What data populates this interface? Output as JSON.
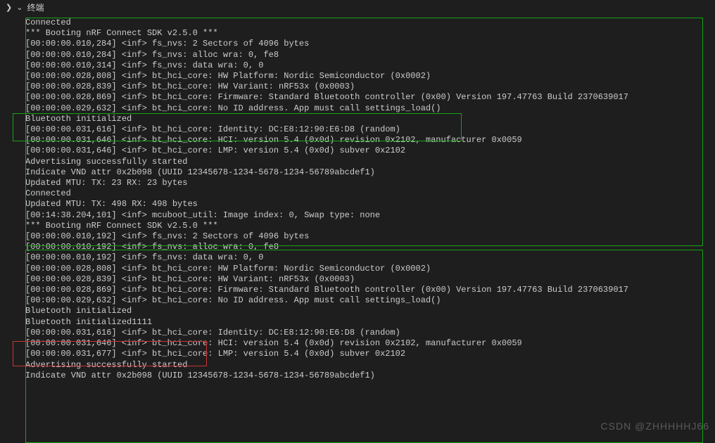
{
  "header": {
    "tab_label": "终端"
  },
  "terminal": {
    "lines": [
      "Connected",
      "*** Booting nRF Connect SDK v2.5.0 ***",
      "[00:00:00.010,284] <inf> fs_nvs: 2 Sectors of 4096 bytes",
      "[00:00:00.010,284] <inf> fs_nvs: alloc wra: 0, fe8",
      "[00:00:00.010,314] <inf> fs_nvs: data wra: 0, 0",
      "[00:00:00.028,808] <inf> bt_hci_core: HW Platform: Nordic Semiconductor (0x0002)",
      "[00:00:00.028,839] <inf> bt_hci_core: HW Variant: nRF53x (0x0003)",
      "[00:00:00.028,869] <inf> bt_hci_core: Firmware: Standard Bluetooth controller (0x00) Version 197.47763 Build 2370639017",
      "[00:00:00.029,632] <inf> bt_hci_core: No ID address. App must call settings_load()",
      "Bluetooth initialized",
      "[00:00:00.031,616] <inf> bt_hci_core: Identity: DC:E8:12:90:E6:D8 (random)",
      "[00:00:00.031,646] <inf> bt_hci_core: HCI: version 5.4 (0x0d) revision 0x2102, manufacturer 0x0059",
      "[00:00:00.031,646] <inf> bt_hci_core: LMP: version 5.4 (0x0d) subver 0x2102",
      "Advertising successfully started",
      "Indicate VND attr 0x2b098 (UUID 12345678-1234-5678-1234-56789abcdef1)",
      "Updated MTU: TX: 23 RX: 23 bytes",
      "Connected",
      "Updated MTU: TX: 498 RX: 498 bytes",
      "[00:14:38.204,101] <inf> mcuboot_util: Image index: 0, Swap type: none",
      "*** Booting nRF Connect SDK v2.5.0 ***",
      "[00:00:00.010,192] <inf> fs_nvs: 2 Sectors of 4096 bytes",
      "[00:00:00.010,192] <inf> fs_nvs: alloc wra: 0, fe8",
      "[00:00:00.010,192] <inf> fs_nvs: data wra: 0, 0",
      "[00:00:00.028,808] <inf> bt_hci_core: HW Platform: Nordic Semiconductor (0x0002)",
      "[00:00:00.028,839] <inf> bt_hci_core: HW Variant: nRF53x (0x0003)",
      "[00:00:00.028,869] <inf> bt_hci_core: Firmware: Standard Bluetooth controller (0x00) Version 197.47763 Build 2370639017",
      "[00:00:00.029,632] <inf> bt_hci_core: No ID address. App must call settings_load()",
      "Bluetooth initialized",
      "Bluetooth initialized1111",
      "[00:00:00.031,616] <inf> bt_hci_core: Identity: DC:E8:12:90:E6:D8 (random)",
      "[00:00:00.031,646] <inf> bt_hci_core: HCI: version 5.4 (0x0d) revision 0x2102, manufacturer 0x0059",
      "[00:00:00.031,677] <inf> bt_hci_core: LMP: version 5.4 (0x0d) subver 0x2102",
      "Advertising successfully started",
      "Indicate VND attr 0x2b098 (UUID 12345678-1234-5678-1234-56789abcdef1)"
    ]
  },
  "watermark": "CSDN @ZHHHHHJ66",
  "colors": {
    "bg": "#1e1e1e",
    "text": "#cccccc",
    "green_box": "#18a218",
    "red_box": "#cc3333"
  }
}
